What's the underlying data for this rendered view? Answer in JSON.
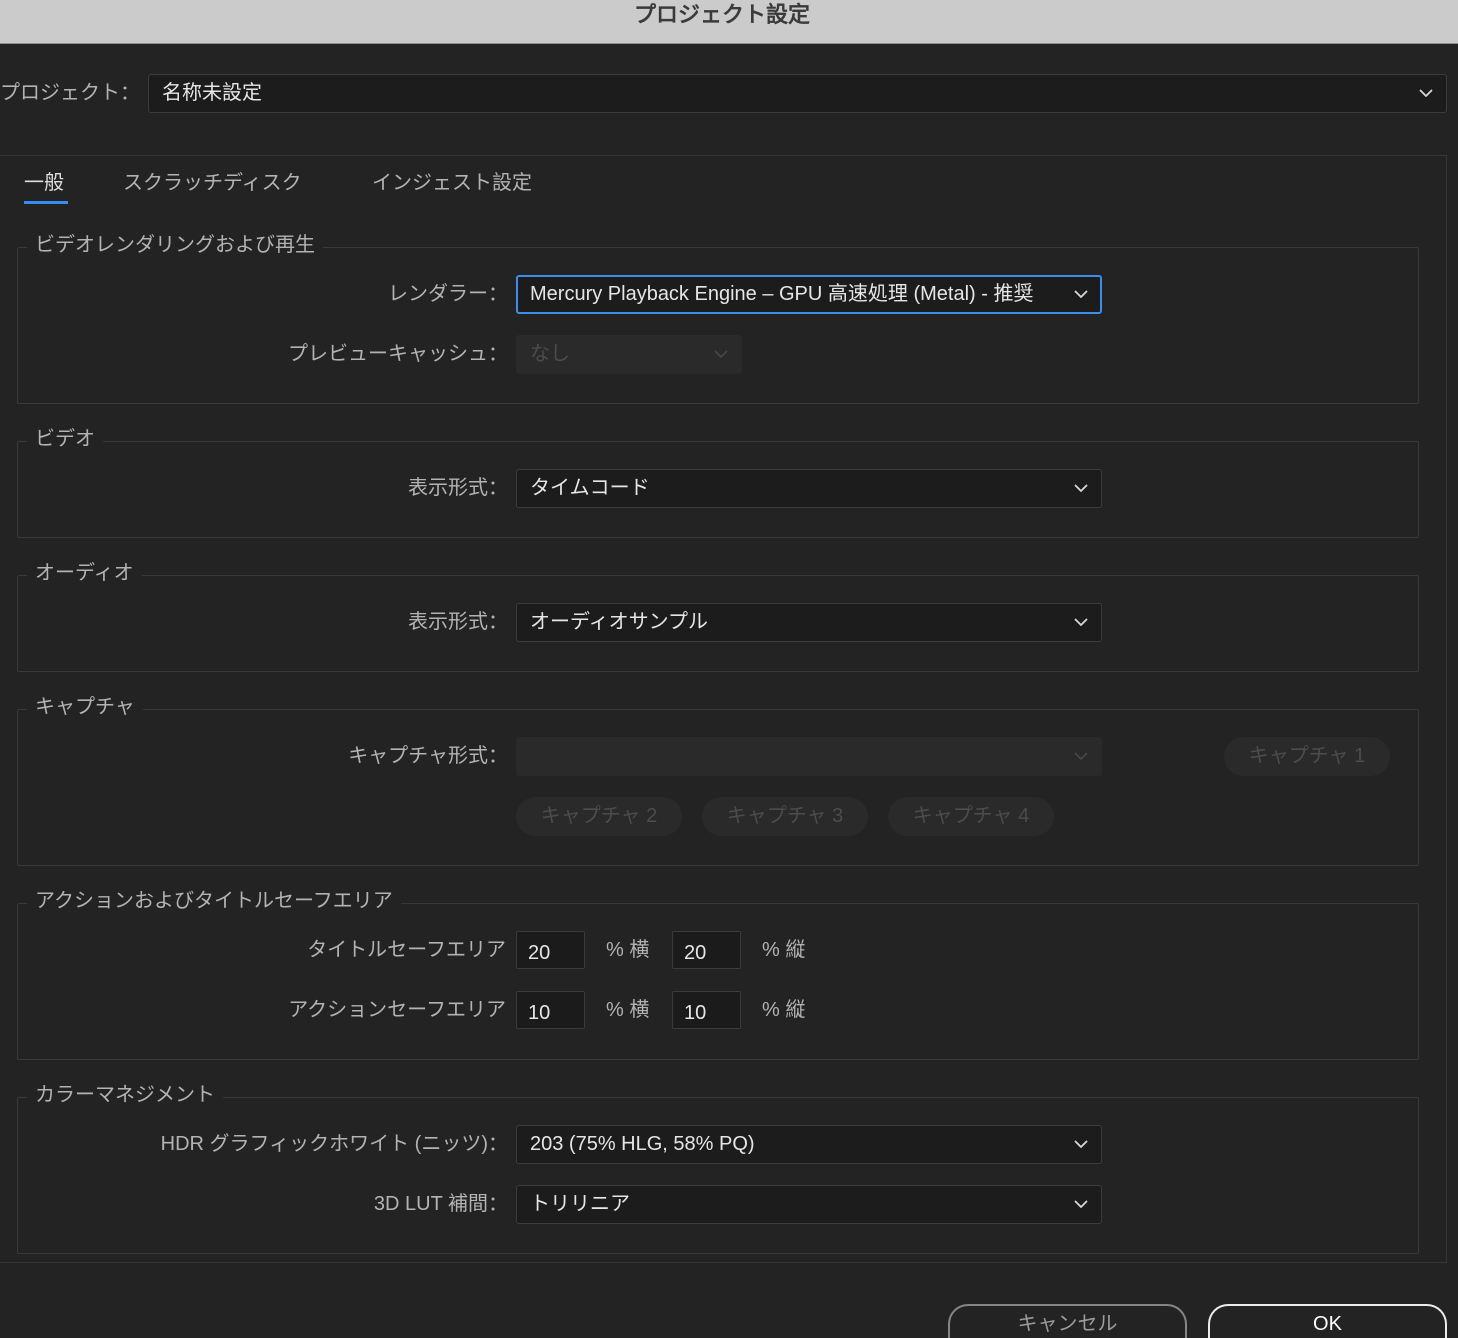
{
  "window": {
    "title": "プロジェクト設定"
  },
  "project": {
    "label": "プロジェクト：",
    "value": "名称未設定"
  },
  "tabs": [
    {
      "label": "一般",
      "selected": true
    },
    {
      "label": "スクラッチディスク",
      "selected": false
    },
    {
      "label": "インジェスト設定",
      "selected": false
    }
  ],
  "rendering": {
    "legend": "ビデオレンダリングおよび再生",
    "renderer": {
      "label": "レンダラー：",
      "value": "Mercury Playback Engine – GPU 高速処理 (Metal) - 推奨",
      "focused": true
    },
    "preview_cache": {
      "label": "プレビューキャッシュ：",
      "value": "なし",
      "enabled": false
    }
  },
  "video": {
    "legend": "ビデオ",
    "display_format": {
      "label": "表示形式：",
      "value": "タイムコード"
    }
  },
  "audio": {
    "legend": "オーディオ",
    "display_format": {
      "label": "表示形式：",
      "value": "オーディオサンプル"
    }
  },
  "capture": {
    "legend": "キャプチャ",
    "format": {
      "label": "キャプチャ形式：",
      "value": "",
      "enabled": false
    },
    "buttons": [
      {
        "label": "キャプチャ 1",
        "enabled": false
      },
      {
        "label": "キャプチャ 2",
        "enabled": false
      },
      {
        "label": "キャプチャ 3",
        "enabled": false
      },
      {
        "label": "キャプチャ 4",
        "enabled": false
      }
    ]
  },
  "safe_areas": {
    "legend": "アクションおよびタイトルセーフエリア",
    "title_safe": {
      "label": "タイトルセーフエリア",
      "horizontal": "20",
      "vertical": "20"
    },
    "action_safe": {
      "label": "アクションセーフエリア",
      "horizontal": "10",
      "vertical": "10"
    },
    "horizontal_unit": "% 横",
    "vertical_unit": "% 縦"
  },
  "color_management": {
    "legend": "カラーマネジメント",
    "hdr_graphics_white": {
      "label": "HDR グラフィックホワイト (ニッツ)：",
      "value": "203 (75% HLG, 58% PQ)"
    },
    "lut_interpolation": {
      "label": "3D LUT 補間：",
      "value": "トリリニア"
    }
  },
  "footer": {
    "cancel_label": "キャンセル",
    "ok_label": "OK"
  },
  "icons": {
    "dropdown": "chevron-down-icon"
  },
  "colors": {
    "background": "#232323",
    "title_bar": "#cbcbcb",
    "accent": "#378ef0",
    "focus_border": "#3b8eea",
    "text": "#e6e6e6",
    "label": "#b3b3b3",
    "disabled_text": "#4c4c4c"
  }
}
